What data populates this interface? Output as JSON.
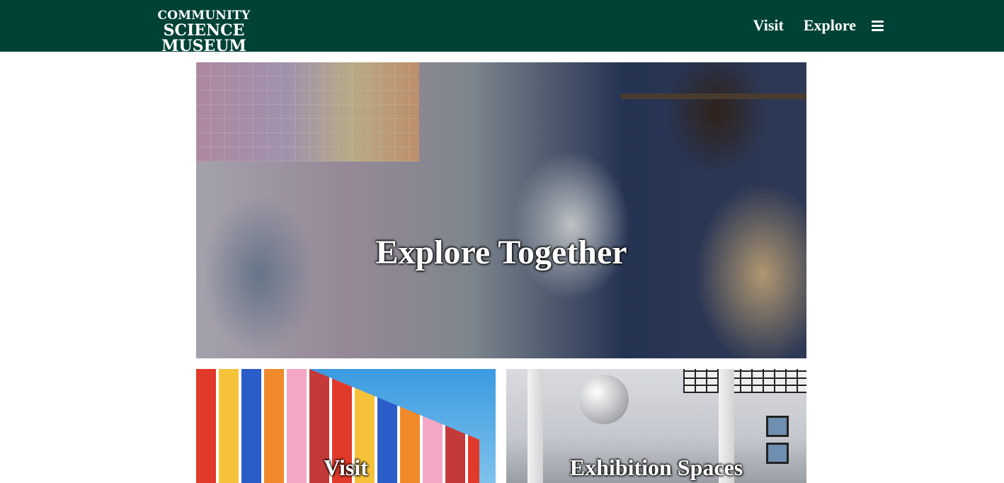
{
  "header": {
    "logo_line1": "COMMUNITY",
    "logo_line2": "SCIENCE MUSEUM",
    "nav": {
      "visit": "Visit",
      "explore": "Explore"
    },
    "menu_icon": "hamburger-menu-icon"
  },
  "colors": {
    "header_bg": "#004236",
    "text_light": "#ffffff",
    "page_bg": "#ffffff"
  },
  "hero": {
    "caption": "Explore Together",
    "image": "scientist-demonstrating-experiment-to-children-photo"
  },
  "tiles": [
    {
      "caption": "Visit",
      "image": "colorful-museum-facade-photo"
    },
    {
      "caption": "Exhibition Spaces",
      "image": "gallery-interior-photo"
    }
  ]
}
